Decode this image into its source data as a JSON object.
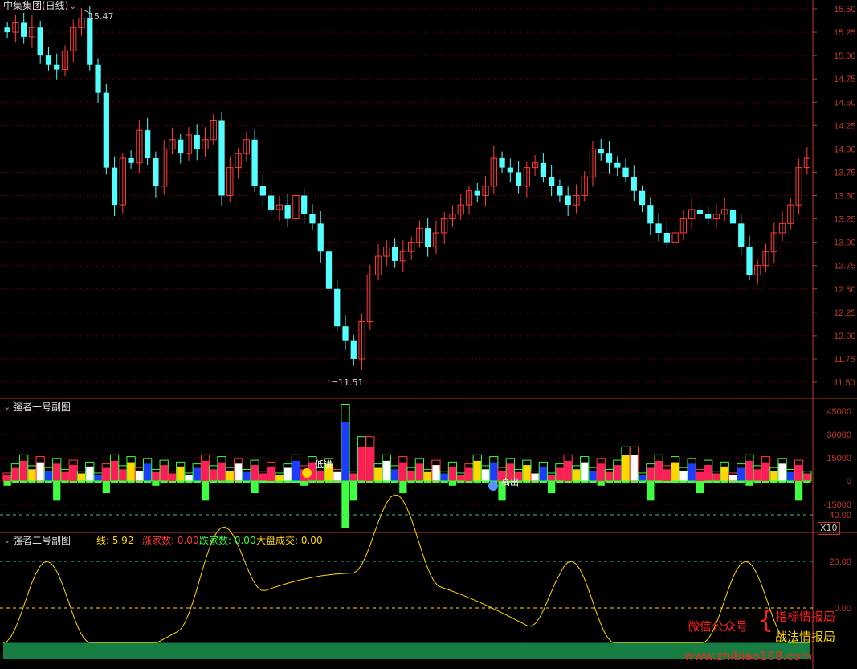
{
  "main_panel": {
    "title": "中集集团(日线)",
    "high_marker": "15.47",
    "low_marker": "11.51",
    "y_ticks": [
      "15.50",
      "15.25",
      "15.00",
      "14.75",
      "14.50",
      "14.25",
      "14.00",
      "13.75",
      "13.50",
      "13.25",
      "13.00",
      "12.75",
      "12.50",
      "12.25",
      "12.00",
      "11.75",
      "11.50"
    ]
  },
  "sub1": {
    "title": "强者一号副图",
    "y_ticks": [
      "45000",
      "30000",
      "15000",
      "0",
      "-15000"
    ],
    "scale_badge": "X10",
    "buy_label": "低进",
    "sell_label": "高出"
  },
  "sub2": {
    "title": "强者二号副图",
    "line_label": "线: 5.92",
    "rise_label": "涨家数: 0.00",
    "fall_label": "跌家数: 0.00",
    "volume_label": "大盘成交: 0.00",
    "y_ticks": [
      "40.00",
      "20.00",
      "0.00"
    ]
  },
  "watermark": {
    "wechat": "微信公众号",
    "line1": "指标情报局",
    "line2": "战法情报局",
    "site": "www.zhibiao168.com"
  },
  "colors": {
    "up": "#ff3c3c",
    "down": "#54ffff",
    "grid": "#8b0000",
    "axis_text": "#c0392b",
    "green": "#40ff40",
    "yellow": "#ffd700"
  },
  "chart_data": {
    "type": "candlestick",
    "close_path": [
      15.25,
      15.35,
      15.2,
      15.3,
      15.0,
      14.9,
      14.85,
      15.05,
      15.3,
      15.4,
      14.9,
      14.6,
      13.8,
      13.4,
      13.9,
      13.85,
      14.2,
      13.9,
      13.6,
      14.0,
      14.1,
      13.95,
      14.15,
      14.0,
      14.1,
      14.3,
      13.5,
      13.8,
      13.95,
      14.1,
      13.6,
      13.5,
      13.35,
      13.4,
      13.25,
      13.5,
      13.3,
      13.2,
      12.9,
      12.5,
      12.1,
      11.95,
      11.75,
      12.15,
      12.65,
      12.85,
      12.95,
      12.8,
      12.9,
      13.0,
      13.15,
      12.95,
      13.1,
      13.25,
      13.3,
      13.4,
      13.55,
      13.5,
      13.6,
      13.9,
      13.8,
      13.75,
      13.6,
      13.8,
      13.85,
      13.7,
      13.6,
      13.5,
      13.4,
      13.5,
      13.7,
      14.0,
      13.95,
      13.85,
      13.8,
      13.7,
      13.55,
      13.4,
      13.2,
      13.1,
      13.0,
      13.1,
      13.25,
      13.35,
      13.3,
      13.25,
      13.3,
      13.35,
      13.2,
      12.95,
      12.65,
      12.75,
      12.9,
      13.1,
      13.2,
      13.4,
      13.8,
      13.9
    ],
    "sub1_series": [
      {
        "name": "线",
        "values": [
          5.92
        ]
      }
    ]
  }
}
